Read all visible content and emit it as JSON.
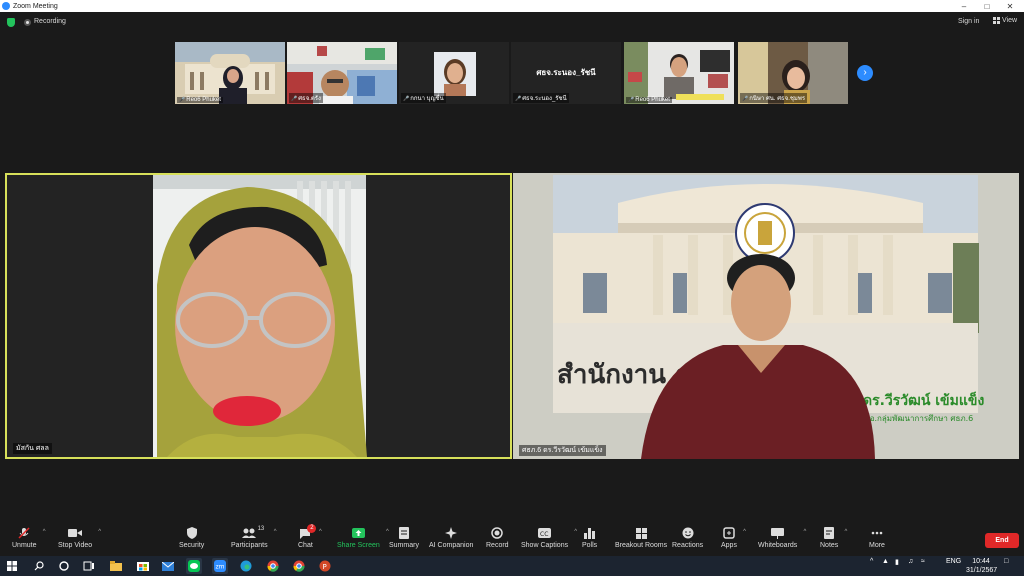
{
  "window": {
    "title": "Zoom Meeting"
  },
  "top": {
    "recording": "Recording",
    "signin": "Sign in",
    "view": "View"
  },
  "thumbnails": [
    {
      "label": "Reo6 Phuket"
    },
    {
      "label": "ศธจ.ตรัง"
    },
    {
      "label": "กกนา บุญชื่น"
    },
    {
      "label": "ศธจ.ระนอง_รัชนี",
      "center": "ศธจ.ระนอง_รัชนี"
    },
    {
      "label": "Reo6 Phuket"
    },
    {
      "label": "กนิษา ศน. ศธจ.ชุมพร"
    }
  ],
  "main": {
    "left_label": "มัสกัน ศลล",
    "right_label": "ศธภ.6 ดร.วีรวัฒน์ เข้มแข็ง",
    "right_banner": "สำนักงาน                    รภาค 6",
    "right_name": "ดร.วีรวัฒน์ เข้มแข็ง",
    "right_sub": "ผอ.กลุ่มพัฒนาการศึกษา ศธภ.6"
  },
  "toolbar": {
    "unmute": "Unmute",
    "stop_video": "Stop Video",
    "security": "Security",
    "participants": "Participants",
    "participants_count": "13",
    "chat": "Chat",
    "chat_badge": "2",
    "share_screen": "Share Screen",
    "summary": "Summary",
    "ai_companion": "AI Companion",
    "record": "Record",
    "show_captions": "Show Captions",
    "polls": "Polls",
    "breakout_rooms": "Breakout Rooms",
    "reactions": "Reactions",
    "apps": "Apps",
    "whiteboards": "Whiteboards",
    "notes": "Notes",
    "more": "More",
    "end": "End"
  },
  "taskbar": {
    "lang": "ENG",
    "time": "10:44",
    "date": "31/1/2567"
  },
  "colors": {
    "accent": "#2d8cff",
    "active_speaker": "#d7e05a",
    "end": "#e02828",
    "share": "#23c35c"
  }
}
